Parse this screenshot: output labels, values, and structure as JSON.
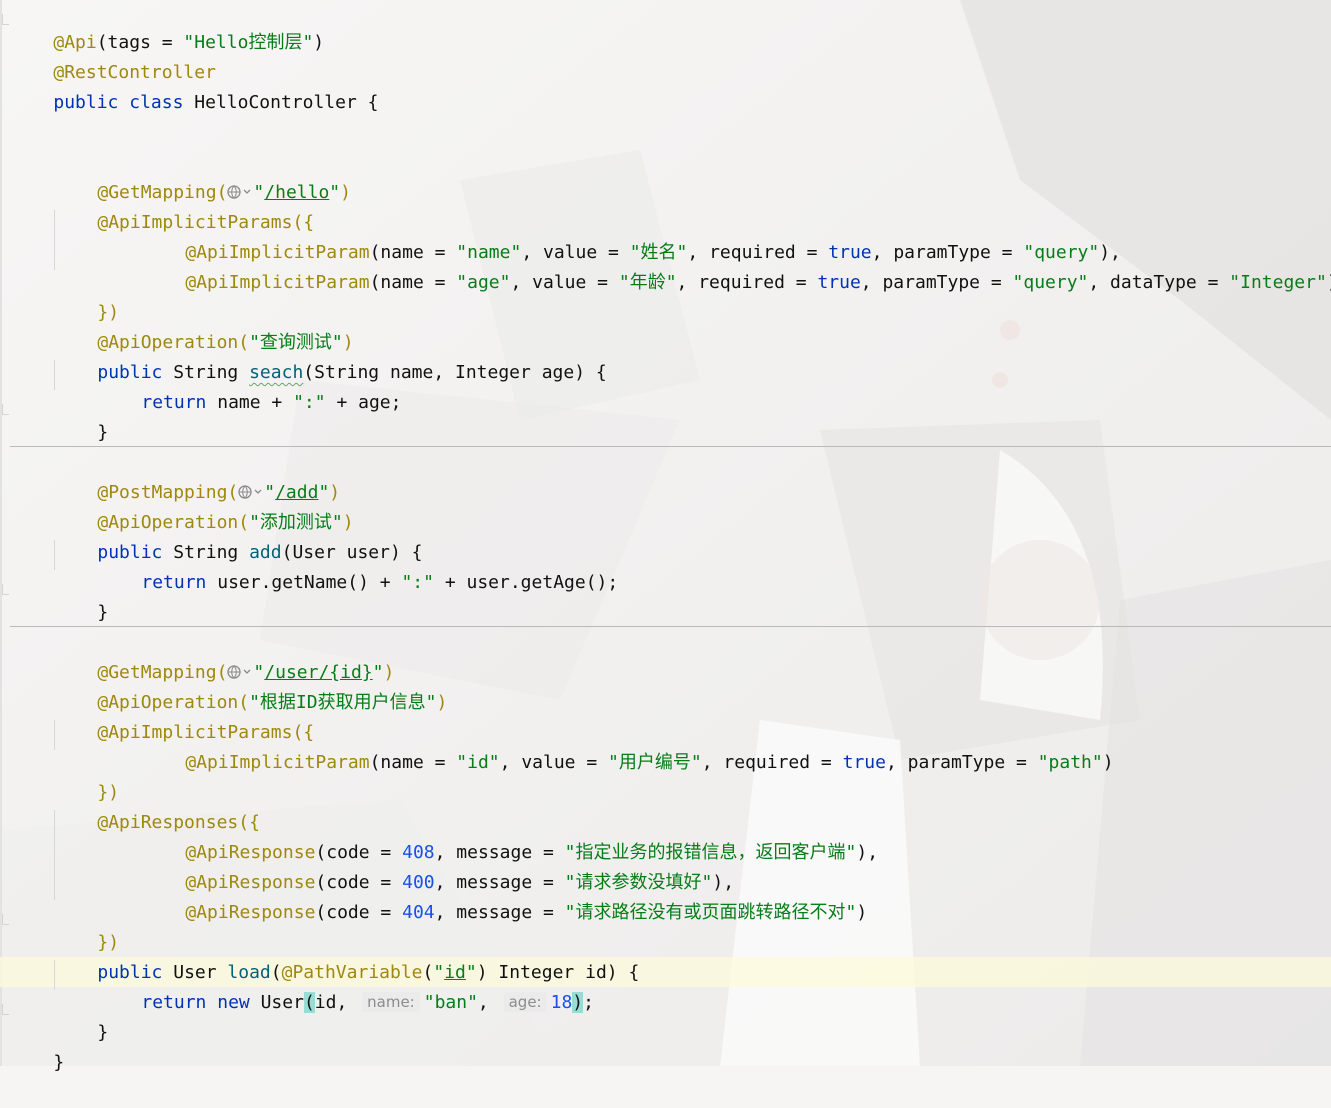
{
  "editor": {
    "colors": {
      "annotation": "#9e880d",
      "keyword": "#0033b3",
      "string": "#067d17",
      "number": "#1750eb",
      "method": "#00627a",
      "current_line": "#fcfada",
      "brace_match": "#99dcd6"
    },
    "icons": {
      "route": "globe-icon",
      "dropdown": "chevron-down-icon"
    },
    "lines": {
      "l1": {
        "ann": "@Api",
        "p1": "(tags = ",
        "s1": "\"Hello控制层\"",
        "p2": ")"
      },
      "l2": {
        "ann": "@RestController"
      },
      "l3": {
        "k1": "public",
        "k2": "class",
        "name": "HelloController",
        "p1": " {"
      },
      "l6": {
        "ann": "@GetMapping",
        "p1": "(",
        "q1": "\"",
        "url": "/hello",
        "q2": "\"",
        "p2": ")"
      },
      "l7": {
        "ann": "@ApiImplicitParams",
        "p1": "({"
      },
      "l8": {
        "ann": "@ApiImplicitParam",
        "p1": "(name = ",
        "s1": "\"name\"",
        "p2": ", value = ",
        "s2": "\"姓名\"",
        "p3": ", required = ",
        "k1": "true",
        "p4": ", paramType = ",
        "s3": "\"query\"",
        "p5": "),"
      },
      "l9": {
        "ann": "@ApiImplicitParam",
        "p1": "(name = ",
        "s1": "\"age\"",
        "p2": ", value = ",
        "s2": "\"年龄\"",
        "p3": ", required = ",
        "k1": "true",
        "p4": ", paramType = ",
        "s3": "\"query\"",
        "p5": ", dataType = ",
        "s4": "\"Integer\"",
        "p6": ")"
      },
      "l10": {
        "ann": "})"
      },
      "l11": {
        "ann": "@ApiOperation",
        "p1": "(",
        "s1": "\"查询测试\"",
        "p2": ")"
      },
      "l12": {
        "k1": "public",
        "t1": " String ",
        "fn": "seach",
        "p1": "(String name, Integer age) {"
      },
      "l13": {
        "k1": "return",
        "p1": " name + ",
        "s1": "\":\"",
        "p2": " + age;"
      },
      "l14": {
        "p1": "}"
      },
      "l16": {
        "ann": "@PostMapping",
        "p1": "(",
        "q1": "\"",
        "url": "/add",
        "q2": "\"",
        "p2": ")"
      },
      "l17": {
        "ann": "@ApiOperation",
        "p1": "(",
        "s1": "\"添加测试\"",
        "p2": ")"
      },
      "l18": {
        "k1": "public",
        "t1": " String ",
        "fn": "add",
        "p1": "(User user) {"
      },
      "l19": {
        "k1": "return",
        "p1": " user.getName() + ",
        "s1": "\":\"",
        "p2": " + user.getAge();"
      },
      "l20": {
        "p1": "}"
      },
      "l22": {
        "ann": "@GetMapping",
        "p1": "(",
        "q1": "\"",
        "url": "/user/{id}",
        "q2": "\"",
        "p2": ")"
      },
      "l23": {
        "ann": "@ApiOperation",
        "p1": "(",
        "s1": "\"根据ID获取用户信息\"",
        "p2": ")"
      },
      "l24": {
        "ann": "@ApiImplicitParams",
        "p1": "({"
      },
      "l25": {
        "ann": "@ApiImplicitParam",
        "p1": "(name = ",
        "s1": "\"id\"",
        "p2": ", value = ",
        "s2": "\"用户编号\"",
        "p3": ", required = ",
        "k1": "true",
        "p4": ", paramType = ",
        "s3": "\"path\"",
        "p5": ")"
      },
      "l26": {
        "ann": "})"
      },
      "l27": {
        "ann": "@ApiResponses",
        "p1": "({"
      },
      "l28": {
        "ann": "@ApiResponse",
        "p1": "(code = ",
        "n1": "408",
        "p2": ", message = ",
        "s1": "\"指定业务的报错信息，返回客户端\"",
        "p3": "),"
      },
      "l29": {
        "ann": "@ApiResponse",
        "p1": "(code = ",
        "n1": "400",
        "p2": ", message = ",
        "s1": "\"请求参数没填好\"",
        "p3": "),"
      },
      "l30": {
        "ann": "@ApiResponse",
        "p1": "(code = ",
        "n1": "404",
        "p2": ", message = ",
        "s1": "\"请求路径没有或页面跳转路径不对\"",
        "p3": ")"
      },
      "l31": {
        "ann": "})"
      },
      "l32": {
        "k1": "public",
        "t1": " User ",
        "fn": "load",
        "p1": "(",
        "ann": "@PathVariable",
        "p2": "(",
        "s1": "\"",
        "s1u": "id",
        "s1e": "\"",
        "p3": ") Integer id) {"
      },
      "l33": {
        "k1": "return",
        "k2": "new",
        "t1": " User",
        "b1": "(",
        "p1": "id, ",
        "h1": "name:",
        "s1": "\"ban\"",
        "p2": ", ",
        "h2": "age:",
        "n1": "18",
        "b2": ")",
        "p3": ";"
      },
      "l34": {
        "p1": "}"
      },
      "l35": {
        "p1": "}"
      }
    }
  }
}
